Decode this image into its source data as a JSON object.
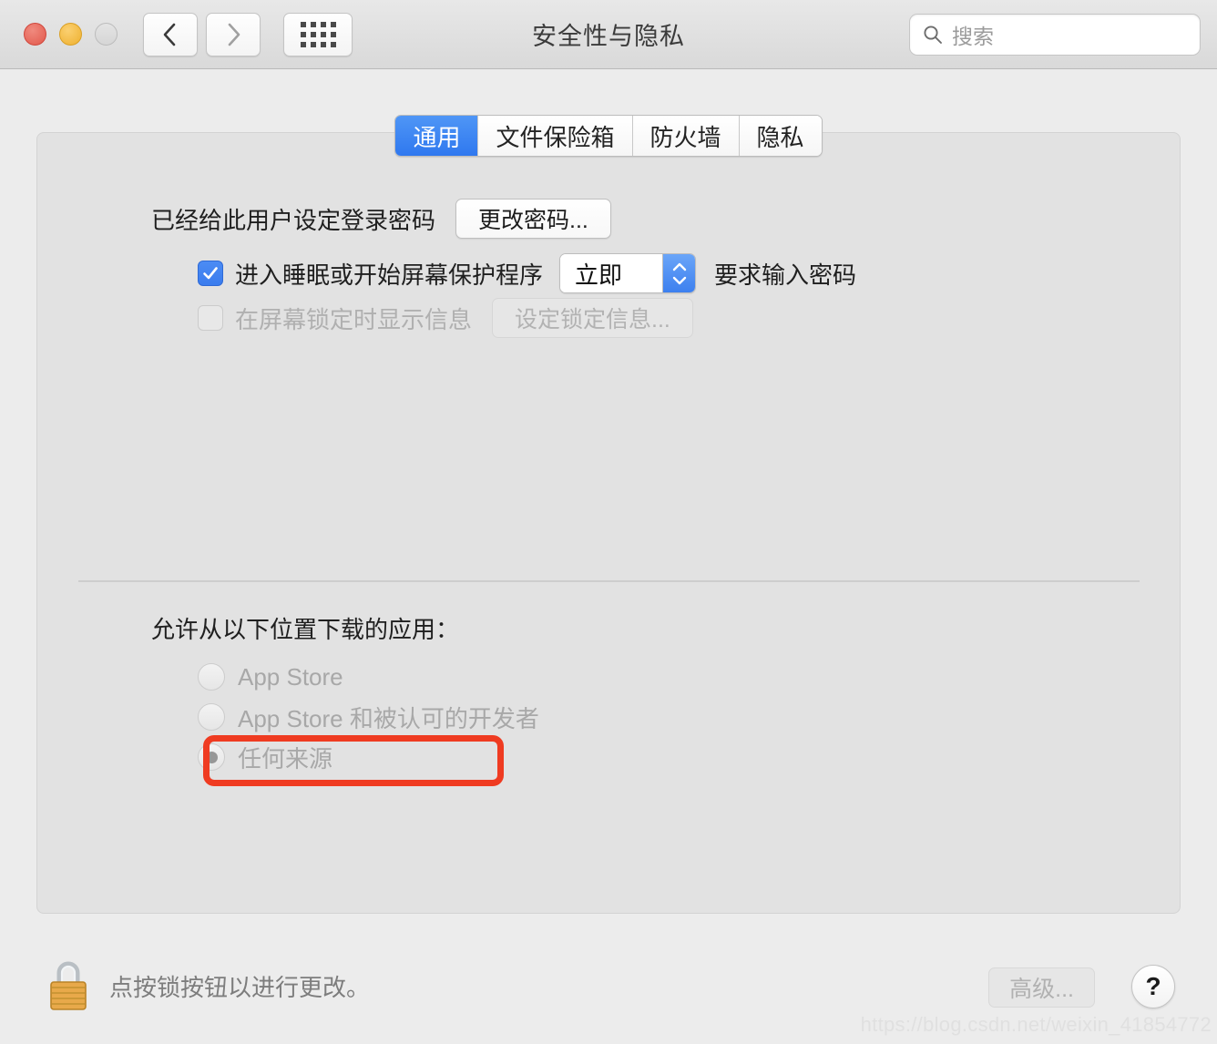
{
  "window": {
    "title": "安全性与隐私",
    "traffic_lights": [
      "close",
      "minimize",
      "zoom"
    ],
    "nav": {
      "back_icon": "chevron-left-icon",
      "forward_icon": "chevron-right-icon",
      "grid_icon": "grid-view-icon"
    },
    "colors": {
      "close": "#e2594c",
      "minimize": "#eeb02f",
      "zoom": "#d6d6d6",
      "accent_blue": "#3a7cee",
      "highlight_red": "#ef3b21",
      "titlebar": "#dedede",
      "panel": "#e2e2e2",
      "window_bg": "#ececec"
    }
  },
  "search": {
    "placeholder": "搜索",
    "icon": "search-icon",
    "value": ""
  },
  "tabs": [
    {
      "label": "通用",
      "active": true
    },
    {
      "label": "文件保险箱",
      "active": false
    },
    {
      "label": "防火墙",
      "active": false
    },
    {
      "label": "隐私",
      "active": false
    }
  ],
  "general": {
    "password_status_label": "已经给此用户设定登录密码",
    "change_password_button": "更改密码...",
    "sleep_checkbox": {
      "label": "进入睡眠或开始屏幕保护程序",
      "checked": true,
      "enabled": true
    },
    "delay_stepper": {
      "value": "立即",
      "icon": "stepper-up-down-icon"
    },
    "require_password_label": "要求输入密码",
    "lock_message_checkbox": {
      "label": "在屏幕锁定时显示信息",
      "checked": false,
      "enabled": false
    },
    "set_lock_message_button": {
      "label": "设定锁定信息...",
      "enabled": false
    }
  },
  "download_sources": {
    "title": "允许从以下位置下载的应用：",
    "options": [
      {
        "label": "App Store",
        "selected": false
      },
      {
        "label": "App Store 和被认可的开发者",
        "selected": false
      },
      {
        "label": "任何来源",
        "selected": true,
        "highlighted": true
      }
    ]
  },
  "footer": {
    "lock_icon": "padlock-closed-icon",
    "message": "点按锁按钮以进行更改。",
    "advanced_button": {
      "label": "高级...",
      "enabled": false
    },
    "help_button": {
      "label": "?"
    }
  },
  "watermark": "https://blog.csdn.net/weixin_41854772"
}
